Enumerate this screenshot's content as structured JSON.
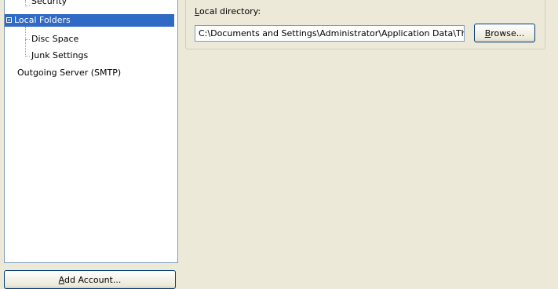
{
  "tree": {
    "items": [
      {
        "label": "Security"
      },
      {
        "label": "Local Folders"
      },
      {
        "label": "Disc Space"
      },
      {
        "label": "Junk Settings"
      },
      {
        "label": "Outgoing Server (SMTP)"
      }
    ],
    "selected_index": 1
  },
  "add_account": {
    "accel": "A",
    "rest": "dd Account..."
  },
  "local_directory": {
    "label_accel": "L",
    "label_rest": "ocal directory:",
    "value": "C:\\Documents and Settings\\Administrator\\Application Data\\Th"
  },
  "browse": {
    "accel": "B",
    "rest": "rowse..."
  },
  "colors": {
    "selection": "#316ac5",
    "window_bg": "#ece9d8",
    "field_border": "#7f9db9"
  }
}
